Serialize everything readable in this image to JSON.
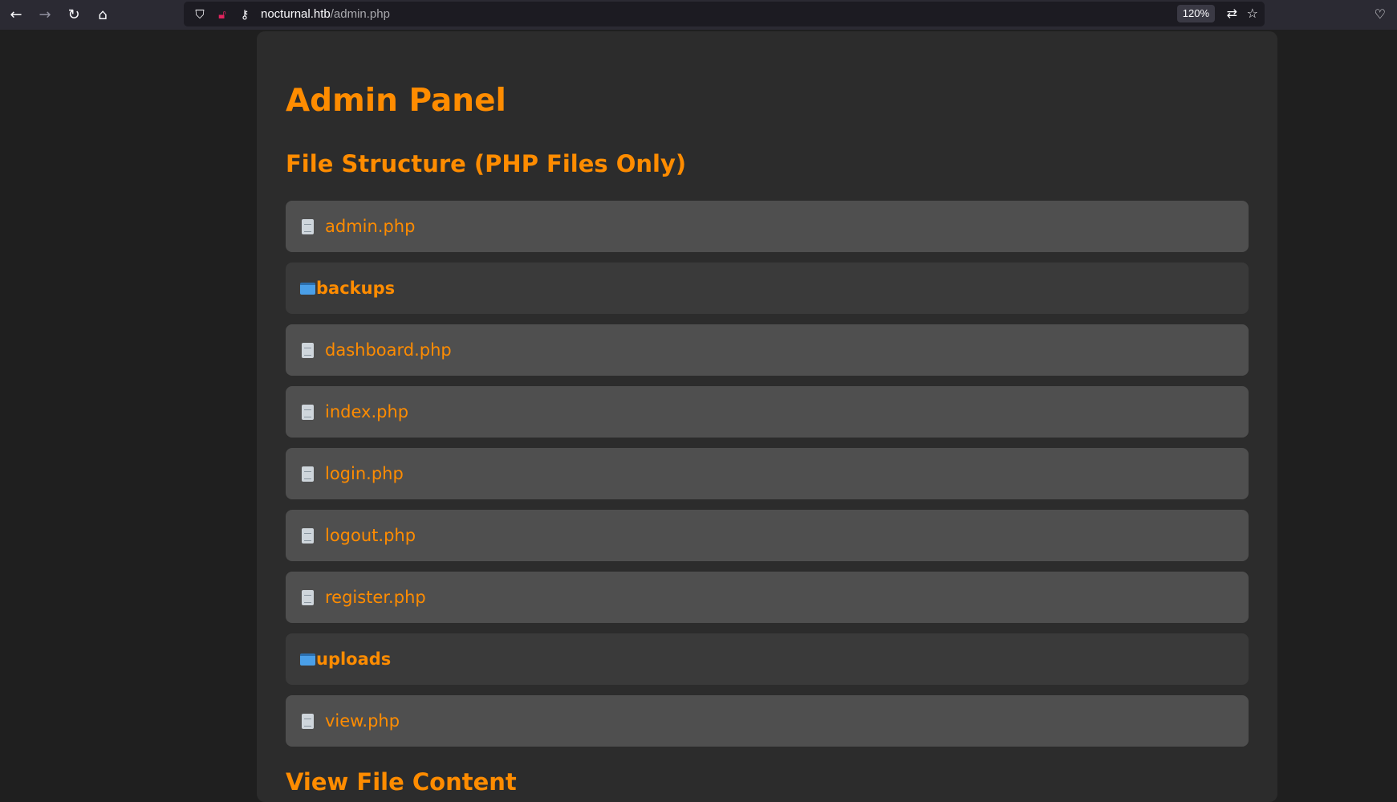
{
  "browser": {
    "url_host": "nocturnal.htb",
    "url_path": "/admin.php",
    "zoom": "120%",
    "icons": [
      "back-icon",
      "forward-icon",
      "reload-icon",
      "home-icon",
      "shield-icon",
      "insecure-lock-icon",
      "key-icon",
      "translate-icon",
      "bookmark-star-icon",
      "pocket-icon"
    ]
  },
  "page": {
    "title": "Admin Panel",
    "file_structure_heading": "File Structure (PHP Files Only)",
    "view_heading": "View File Content",
    "items": [
      {
        "name": "admin.php",
        "type": "file"
      },
      {
        "name": "backups",
        "type": "folder"
      },
      {
        "name": "dashboard.php",
        "type": "file"
      },
      {
        "name": "index.php",
        "type": "file"
      },
      {
        "name": "login.php",
        "type": "file"
      },
      {
        "name": "logout.php",
        "type": "file"
      },
      {
        "name": "register.php",
        "type": "file"
      },
      {
        "name": "uploads",
        "type": "folder"
      },
      {
        "name": "view.php",
        "type": "file"
      }
    ]
  },
  "colors": {
    "accent": "#ff8c00",
    "file_row": "#4f4f4f",
    "folder_row": "#3a3a3a",
    "panel": "#2c2c2c"
  }
}
